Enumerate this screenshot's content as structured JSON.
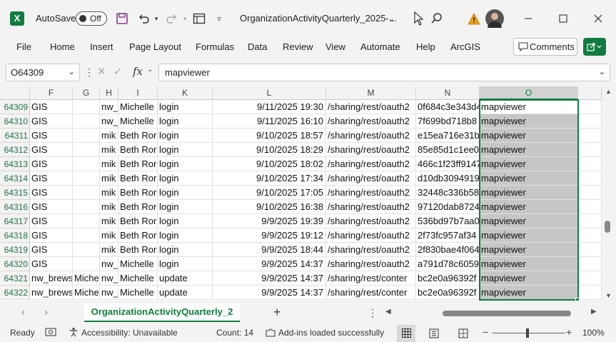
{
  "titlebar": {
    "autosave_label": "AutoSave",
    "toggle_state": "Off",
    "filename": "OrganizationActivityQuarterly_2025-..."
  },
  "menu": [
    "File",
    "Home",
    "Insert",
    "Page Layout",
    "Formulas",
    "Data",
    "Review",
    "View",
    "Automate",
    "Help",
    "ArcGIS"
  ],
  "comments_label": "Comments",
  "formula_bar": {
    "name_box": "O64309",
    "fx": "fx",
    "formula": "mapviewer"
  },
  "columns": [
    "F",
    "G",
    "H",
    "I",
    "K",
    "L",
    "M",
    "N",
    "O"
  ],
  "rows": [
    {
      "num": "64309",
      "F": "GIS",
      "G": "",
      "H": "nw_",
      "I": "Michelle",
      "K": "login",
      "L": "9/11/2025 19:30",
      "M": "/sharing/rest/oauth2",
      "N": "0f684c3e343d4",
      "O": "mapviewer"
    },
    {
      "num": "64310",
      "F": "GIS",
      "G": "",
      "H": "nw_",
      "I": "Michelle",
      "K": "login",
      "L": "9/11/2025 16:10",
      "M": "/sharing/rest/oauth2",
      "N": "7f699bd718b8",
      "O": "mapviewer"
    },
    {
      "num": "64311",
      "F": "GIS",
      "G": "",
      "H": "mik",
      "I": "Beth Ror",
      "K": "login",
      "L": "9/10/2025 18:57",
      "M": "/sharing/rest/oauth2",
      "N": "e15ea716e31b",
      "O": "mapviewer"
    },
    {
      "num": "64312",
      "F": "GIS",
      "G": "",
      "H": "mik",
      "I": "Beth Ror",
      "K": "login",
      "L": "9/10/2025 18:29",
      "M": "/sharing/rest/oauth2",
      "N": "85e85d1c1ee0",
      "O": "mapviewer"
    },
    {
      "num": "64313",
      "F": "GIS",
      "G": "",
      "H": "mik",
      "I": "Beth Ror",
      "K": "login",
      "L": "9/10/2025 18:02",
      "M": "/sharing/rest/oauth2",
      "N": "466c1f23ff9147",
      "O": "mapviewer"
    },
    {
      "num": "64314",
      "F": "GIS",
      "G": "",
      "H": "mik",
      "I": "Beth Ror",
      "K": "login",
      "L": "9/10/2025 17:34",
      "M": "/sharing/rest/oauth2",
      "N": "d10db3094919",
      "O": "mapviewer"
    },
    {
      "num": "64315",
      "F": "GIS",
      "G": "",
      "H": "mik",
      "I": "Beth Ror",
      "K": "login",
      "L": "9/10/2025 17:05",
      "M": "/sharing/rest/oauth2",
      "N": "32448c336b58",
      "O": "mapviewer"
    },
    {
      "num": "64316",
      "F": "GIS",
      "G": "",
      "H": "mik",
      "I": "Beth Ror",
      "K": "login",
      "L": "9/10/2025 16:38",
      "M": "/sharing/rest/oauth2",
      "N": "97120dab8724",
      "O": "mapviewer"
    },
    {
      "num": "64317",
      "F": "GIS",
      "G": "",
      "H": "mik",
      "I": "Beth Ror",
      "K": "login",
      "L": "9/9/2025 19:39",
      "M": "/sharing/rest/oauth2",
      "N": "536bd97b7aa0",
      "O": "mapviewer"
    },
    {
      "num": "64318",
      "F": "GIS",
      "G": "",
      "H": "mik",
      "I": "Beth Ror",
      "K": "login",
      "L": "9/9/2025 19:12",
      "M": "/sharing/rest/oauth2",
      "N": "2f73fc957af34",
      "O": "mapviewer"
    },
    {
      "num": "64319",
      "F": "GIS",
      "G": "",
      "H": "mik",
      "I": "Beth Ror",
      "K": "login",
      "L": "9/9/2025 18:44",
      "M": "/sharing/rest/oauth2",
      "N": "2f830bae4f064",
      "O": "mapviewer"
    },
    {
      "num": "64320",
      "F": "GIS",
      "G": "",
      "H": "nw_",
      "I": "Michelle",
      "K": "login",
      "L": "9/9/2025 14:37",
      "M": "/sharing/rest/oauth2",
      "N": "a791d78c6059",
      "O": "mapviewer"
    },
    {
      "num": "64321",
      "F": "nw_brews",
      "G": "Miche",
      "H": "nw_",
      "I": "Michelle",
      "K": "update",
      "L": "9/9/2025 14:37",
      "M": "/sharing/rest/conter",
      "N": "bc2e0a96392f",
      "O": "mapviewer"
    },
    {
      "num": "64322",
      "F": "nw_brews",
      "G": "Miche",
      "H": "nw_",
      "I": "Michelle",
      "K": "update",
      "L": "9/9/2025 14:37",
      "M": "/sharing/rest/conter",
      "N": "bc2e0a96392f",
      "O": "mapviewer"
    }
  ],
  "sheet_tab": "OrganizationActivityQuarterly_2",
  "status": {
    "ready": "Ready",
    "accessibility": "Accessibility: Unavailable",
    "count": "Count: 14",
    "addins": "Add-ins loaded successfully",
    "zoom": "100%"
  },
  "colors": {
    "accent": "#107c41",
    "selection": "#c6c6c6"
  }
}
